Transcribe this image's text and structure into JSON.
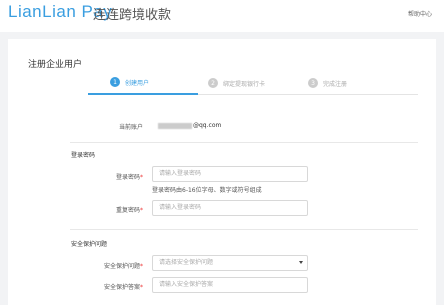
{
  "header": {
    "logo_text": "LianLian Pay",
    "logo_cn": "连连跨境收款",
    "help": "帮助中心"
  },
  "page": {
    "title": "注册企业用户"
  },
  "steps": [
    {
      "num": "1",
      "label": "创建用户"
    },
    {
      "num": "2",
      "label": "绑定提现银行卡"
    },
    {
      "num": "3",
      "label": "完成注册"
    }
  ],
  "account": {
    "label": "当前账户",
    "value_suffix": "@qq.com"
  },
  "login_password": {
    "section": "登录密码",
    "password_label": "登录密码",
    "password_placeholder": "请输入登录密码",
    "hint": "登录密码由6-16位字母、数字或符号组成",
    "repeat_label": "重复密码",
    "repeat_placeholder": "请输入登录密码",
    "required_mark": "*"
  },
  "security": {
    "section": "安全保护问题",
    "question_label": "安全保护问题",
    "question_placeholder": "请选择安全保护问题",
    "answer_label": "安全保护答案",
    "answer_placeholder": "请输入安全保护答案",
    "required_mark": "*"
  }
}
